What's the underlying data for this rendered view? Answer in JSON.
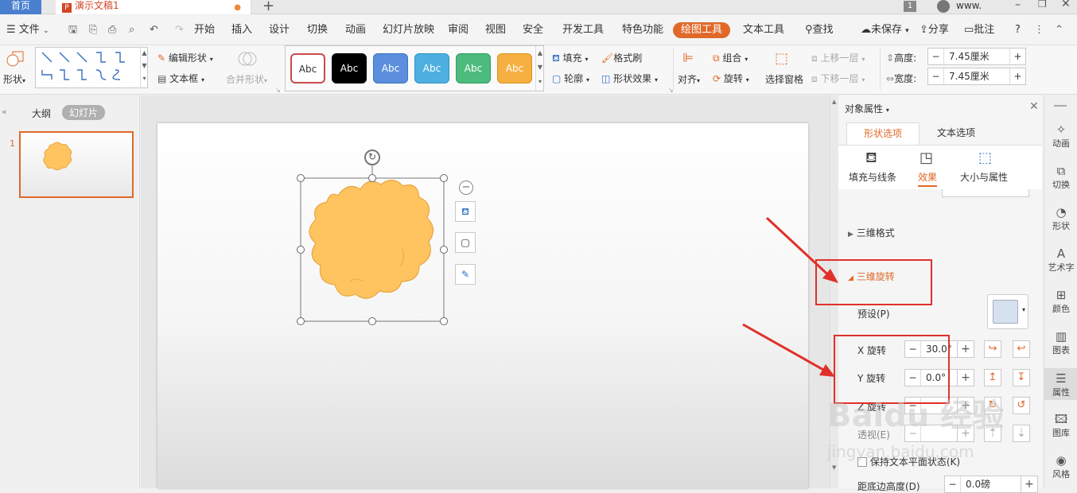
{
  "tabs": {
    "home": "首页",
    "doc": "演示文稿1",
    "new": "+"
  },
  "titlebar": {
    "page_badge": "1",
    "user": "www."
  },
  "menu": {
    "file": "文件",
    "items": [
      "开始",
      "插入",
      "设计",
      "切换",
      "动画",
      "幻灯片放映",
      "审阅",
      "视图",
      "安全",
      "开发工具",
      "特色功能",
      "绘图工具",
      "文本工具"
    ],
    "active": "绘图工具",
    "search": "查找",
    "save_status": "未保存",
    "share": "分享",
    "comment": "批注",
    "help": "?"
  },
  "ribbon": {
    "shape": "形状",
    "edit_shape": "编辑形状",
    "textbox": "文本框",
    "merge_shape": "合并形状",
    "style_label": "Abc",
    "fill": "填充",
    "format_brush": "格式刷",
    "outline": "轮廓",
    "shape_effect": "形状效果",
    "align": "对齐",
    "group": "组合",
    "rotate": "旋转",
    "selection_pane": "选择窗格",
    "bring_forward": "上移一层",
    "send_backward": "下移一层",
    "height_label": "高度:",
    "height_value": "7.45厘米",
    "width_label": "宽度:",
    "width_value": "7.45厘米",
    "colors": {
      "accent": "#e0692a",
      "shape_fill": "#ffc460",
      "shape_stroke": "#e8a640"
    }
  },
  "leftpanel": {
    "outline_tab": "大纲",
    "slides_tab": "幻灯片",
    "slide_number": "1"
  },
  "rightpanel": {
    "title": "对象属性",
    "tab_shape": "形状选项",
    "tab_text": "文本选项",
    "sub_fill": "填充与线条",
    "sub_effect": "效果",
    "sub_size": "大小与属性",
    "section_3d_format": "三维格式",
    "section_3d_rotation": "三维旋转",
    "preset": "预设(P)",
    "x_rotation": "X 旋转",
    "x_value": "30.0°",
    "y_rotation": "Y 旋转",
    "y_value": "0.0°",
    "z_rotation": "Z 旋转",
    "perspective": "透视(E)",
    "keep_text_flat": "保持文本平面状态(K)",
    "distance": "距底边高度(D)",
    "distance_value": "0.0磅"
  },
  "sidebar": [
    "动画",
    "切换",
    "形状",
    "艺术字",
    "颜色",
    "图表",
    "属性",
    "图库",
    "风格"
  ],
  "watermark": {
    "main": "Baidu 经验",
    "url": "jingyan.baidu.com"
  }
}
